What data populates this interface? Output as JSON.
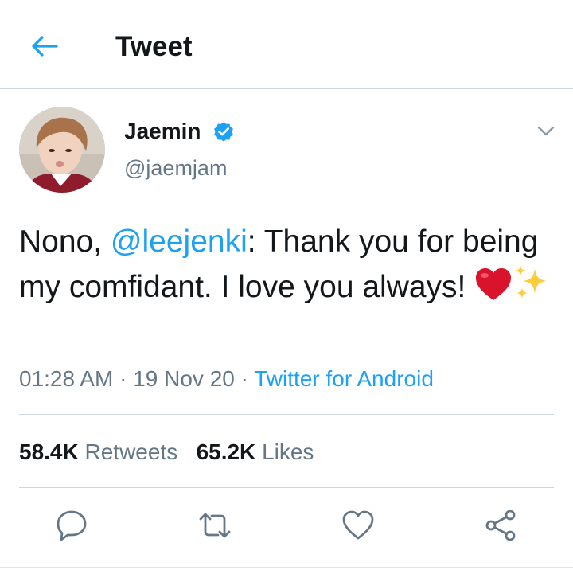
{
  "header": {
    "title": "Tweet",
    "back_icon": "arrow-left-icon"
  },
  "colors": {
    "accent": "#1da1f2",
    "text": "#14171a",
    "muted": "#657786",
    "divider": "#ccd6dd",
    "heart": "#d8132b"
  },
  "tweet": {
    "author": {
      "display_name": "Jaemin",
      "handle": "@jaemjam",
      "verified": true
    },
    "text": {
      "prefix": "Nono, ",
      "mention": "@leejenki",
      "body": ": Thank you for being my comfidant.  I love you always! ",
      "emojis": [
        "red-heart-emoji",
        "sparkles-emoji"
      ]
    },
    "time": "01:28 AM",
    "separator": "·",
    "date": "19 Nov 20",
    "source": "Twitter for Android"
  },
  "stats": {
    "retweets_count": "58.4K",
    "retweets_label": "Retweets",
    "likes_count": "65.2K",
    "likes_label": "Likes"
  },
  "actions": [
    {
      "name": "reply",
      "icon": "reply-icon"
    },
    {
      "name": "retweet",
      "icon": "retweet-icon"
    },
    {
      "name": "like",
      "icon": "heart-icon"
    },
    {
      "name": "share",
      "icon": "share-icon"
    }
  ]
}
